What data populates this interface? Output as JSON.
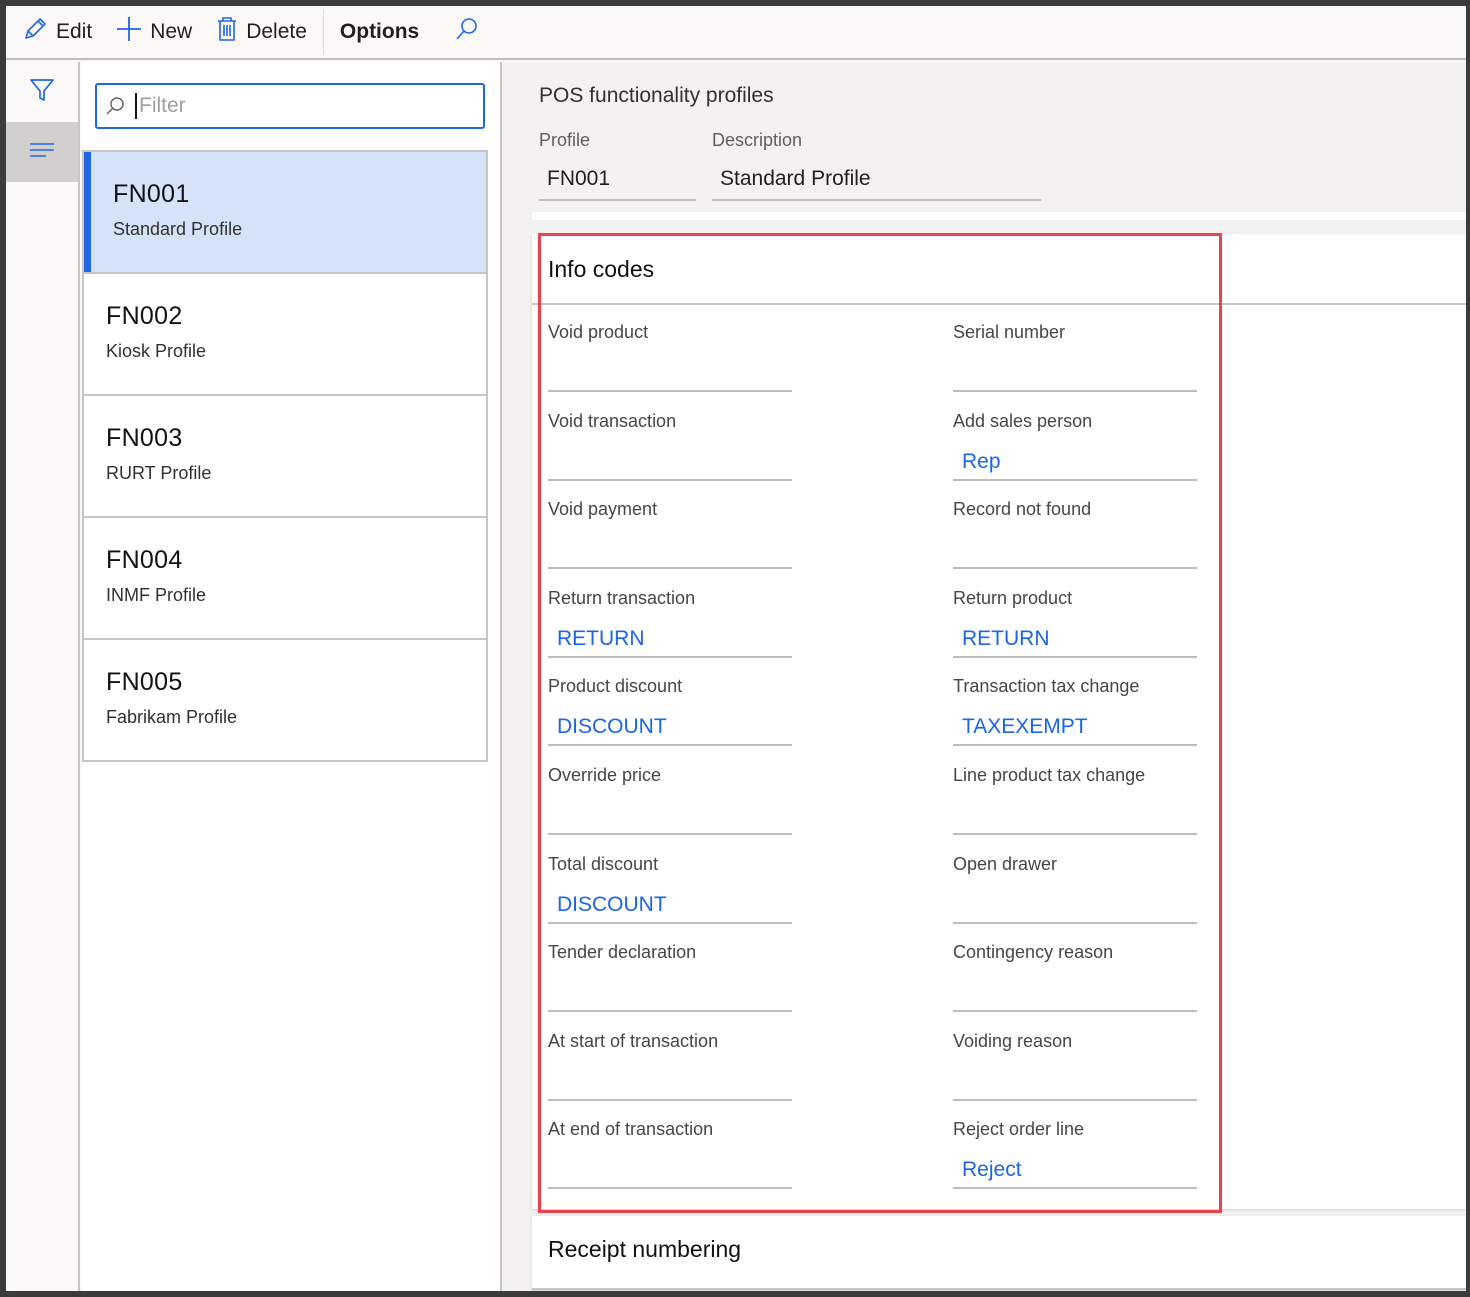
{
  "toolbar": {
    "edit_label": "Edit",
    "new_label": "New",
    "delete_label": "Delete",
    "options_label": "Options"
  },
  "rail": {
    "items": [
      {
        "icon": "filter-icon"
      },
      {
        "icon": "list-icon",
        "active": true
      }
    ]
  },
  "list": {
    "filter_placeholder": "Filter",
    "filter_value": "",
    "items": [
      {
        "id": "FN001",
        "description": "Standard Profile",
        "selected": true
      },
      {
        "id": "FN002",
        "description": "Kiosk Profile"
      },
      {
        "id": "FN003",
        "description": "RURT Profile"
      },
      {
        "id": "FN004",
        "description": "INMF Profile"
      },
      {
        "id": "FN005",
        "description": "Fabrikam Profile"
      }
    ]
  },
  "main": {
    "page_title": "POS functionality profiles",
    "profile_label": "Profile",
    "profile_value": "FN001",
    "description_label": "Description",
    "description_value": "Standard Profile",
    "info_codes": {
      "title": "Info codes",
      "left": [
        {
          "label": "Void product",
          "value": ""
        },
        {
          "label": "Void transaction",
          "value": ""
        },
        {
          "label": "Void payment",
          "value": ""
        },
        {
          "label": "Return transaction",
          "value": "RETURN"
        },
        {
          "label": "Product discount",
          "value": "DISCOUNT"
        },
        {
          "label": "Override price",
          "value": ""
        },
        {
          "label": "Total discount",
          "value": "DISCOUNT"
        },
        {
          "label": "Tender declaration",
          "value": ""
        },
        {
          "label": "At start of transaction",
          "value": ""
        },
        {
          "label": "At end of transaction",
          "value": ""
        }
      ],
      "right": [
        {
          "label": "Serial number",
          "value": ""
        },
        {
          "label": "Add sales person",
          "value": "Rep"
        },
        {
          "label": "Record not found",
          "value": ""
        },
        {
          "label": "Return product",
          "value": "RETURN"
        },
        {
          "label": "Transaction tax change",
          "value": "TAXEXEMPT"
        },
        {
          "label": "Line product tax change",
          "value": ""
        },
        {
          "label": "Open drawer",
          "value": ""
        },
        {
          "label": "Contingency reason",
          "value": ""
        },
        {
          "label": "Voiding reason",
          "value": ""
        },
        {
          "label": "Reject order line",
          "value": "Reject"
        }
      ]
    },
    "receipt_numbering": {
      "title": "Receipt numbering"
    }
  },
  "colors": {
    "accent": "#2266e3",
    "link_value": "#1a66e6",
    "selected_row": "#d5e3f8",
    "highlight_border": "#e8424a"
  }
}
